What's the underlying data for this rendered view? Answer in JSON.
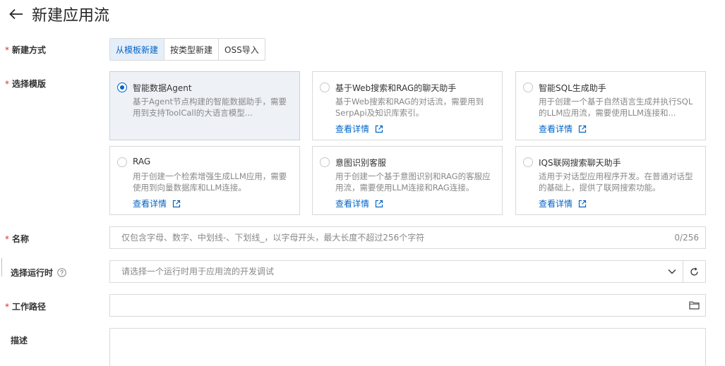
{
  "header": {
    "title": "新建应用流",
    "back_icon": "arrow-left-icon"
  },
  "form": {
    "method": {
      "label": "新建方式",
      "options": [
        "从模板新建",
        "按类型新建",
        "OSS导入"
      ],
      "selected": "从模板新建"
    },
    "template": {
      "label": "选择模版",
      "link_label": "查看详情",
      "cards": [
        {
          "title": "智能数据Agent",
          "desc": "基于Agent节点构建的智能数据助手，需要用到支持ToolCall的大语言模型...",
          "selected": true,
          "has_link": false
        },
        {
          "title": "基于Web搜索和RAG的聊天助手",
          "desc": "基于Web搜索和RAG的对话流，需要用到SerpApi及知识库索引。",
          "selected": false,
          "has_link": true
        },
        {
          "title": "智能SQL生成助手",
          "desc": "用于创建一个基于自然语言生成并执行SQL的LLM应用流，需要使用LLM连接和...",
          "selected": false,
          "has_link": true
        },
        {
          "title": "RAG",
          "desc": "用于创建一个检索增强生成LLM应用，需要使用到向量数据库和LLM连接。",
          "selected": false,
          "has_link": true
        },
        {
          "title": "意图识别客服",
          "desc": "用于创建一个基于意图识别和RAG的客服应用流，需要使用LLM连接和RAG连接。",
          "selected": false,
          "has_link": true
        },
        {
          "title": "IQS联网搜索聊天助手",
          "desc": "适用于对话型应用程序开发。在普通对话型的基础上，提供了联网搜索功能。",
          "selected": false,
          "has_link": true
        }
      ]
    },
    "name": {
      "label": "名称",
      "placeholder": "仅包含字母、数字、中划线-、下划线_，以字母开头，最大长度不超过256个字符",
      "counter": "0/256"
    },
    "runtime": {
      "label": "选择运行时",
      "placeholder": "请选择一个运行时用于应用流的开发调试"
    },
    "path": {
      "label": "工作路径",
      "value": ""
    },
    "description": {
      "label": "描述"
    }
  },
  "colors": {
    "accent": "#0064c8",
    "required": "#d93026",
    "selected_card_bg": "#eef2f7"
  }
}
